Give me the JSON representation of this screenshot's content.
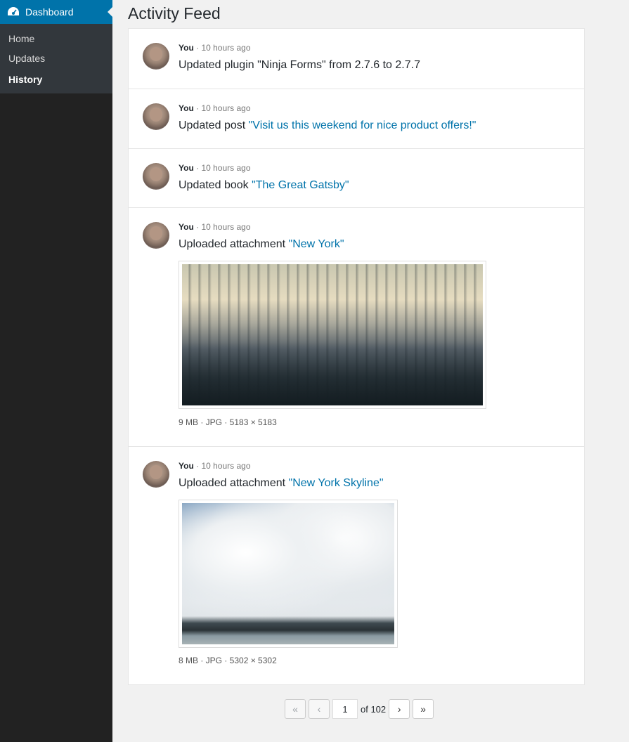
{
  "sidebar": {
    "dashboard_label": "Dashboard",
    "items": [
      {
        "label": "Home"
      },
      {
        "label": "Updates"
      },
      {
        "label": "History"
      }
    ]
  },
  "page_title": "Activity Feed",
  "feed": [
    {
      "who": "You",
      "time": "10 hours ago",
      "text": "Updated plugin \"Ninja Forms\" from 2.7.6 to 2.7.7",
      "link": ""
    },
    {
      "who": "You",
      "time": "10 hours ago",
      "text": "Updated post ",
      "link": "\"Visit us this weekend for nice product offers!\""
    },
    {
      "who": "You",
      "time": "10 hours ago",
      "text": "Updated book ",
      "link": "\"The Great Gatsby\""
    },
    {
      "who": "You",
      "time": "10 hours ago",
      "text": "Uploaded attachment ",
      "link": "\"New York\"",
      "file": "9 MB · JPG · 5183 × 5183"
    },
    {
      "who": "You",
      "time": "10 hours ago",
      "text": "Uploaded attachment ",
      "link": "\"New York Skyline\"",
      "file": "8 MB · JPG · 5302 × 5302"
    }
  ],
  "pagination": {
    "first": "«",
    "prev": "‹",
    "current": "1",
    "of_label": "of 102",
    "next": "›",
    "last": "»"
  },
  "colors": {
    "accent": "#0073aa",
    "sidebar": "#222222",
    "submenu": "#32373c"
  }
}
